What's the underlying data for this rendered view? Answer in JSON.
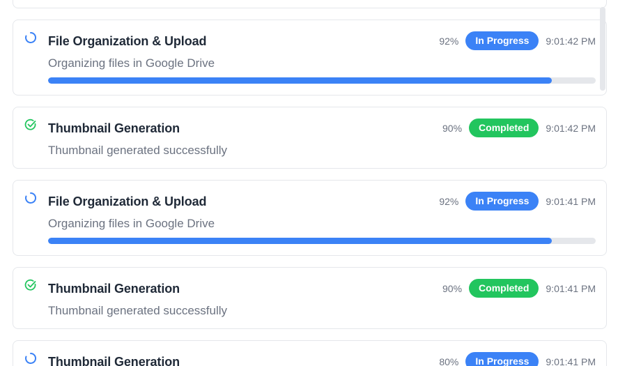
{
  "colors": {
    "accent_blue": "#3b82f6",
    "success_green": "#22c55e",
    "track_gray": "#e5e7eb"
  },
  "activity_log": [
    {
      "title": "File Organization & Upload",
      "subtitle": "Organizing files in Google Drive",
      "percent_label": "92%",
      "progress": 0.92,
      "status": "In Progress",
      "time": "9:01:42 PM",
      "icon": "spinner-icon"
    },
    {
      "title": "Thumbnail Generation",
      "subtitle": "Thumbnail generated successfully",
      "percent_label": "90%",
      "status": "Completed",
      "time": "9:01:42 PM",
      "icon": "check-circle-icon"
    },
    {
      "title": "File Organization & Upload",
      "subtitle": "Organizing files in Google Drive",
      "percent_label": "92%",
      "progress": 0.92,
      "status": "In Progress",
      "time": "9:01:41 PM",
      "icon": "spinner-icon"
    },
    {
      "title": "Thumbnail Generation",
      "subtitle": "Thumbnail generated successfully",
      "percent_label": "90%",
      "status": "Completed",
      "time": "9:01:41 PM",
      "icon": "check-circle-icon"
    },
    {
      "title": "Thumbnail Generation",
      "percent_label": "80%",
      "status": "In Progress",
      "time": "9:01:41 PM",
      "icon": "spinner-icon"
    }
  ]
}
